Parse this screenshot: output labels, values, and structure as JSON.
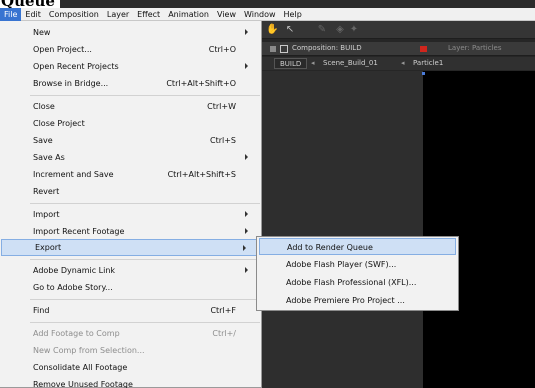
{
  "title_fragment": "Queue",
  "menubar": {
    "items": [
      {
        "label": "File",
        "active": true
      },
      {
        "label": "Edit"
      },
      {
        "label": "Composition"
      },
      {
        "label": "Layer"
      },
      {
        "label": "Effect"
      },
      {
        "label": "Animation"
      },
      {
        "label": "View"
      },
      {
        "label": "Window"
      },
      {
        "label": "Help"
      }
    ]
  },
  "panel": {
    "composition_title": "Composition: BUILD",
    "layer_title": "Layer: Particles",
    "breadcrumbs": [
      "BUILD",
      "Scene_Build_01",
      "Particle1"
    ],
    "breadcrumb_sep": "◂"
  },
  "file_menu": {
    "items": [
      {
        "label": "New",
        "shortcut": "",
        "submenu": true
      },
      {
        "label": "Open Project...",
        "shortcut": "Ctrl+O"
      },
      {
        "label": "Open Recent Projects",
        "shortcut": "",
        "submenu": true
      },
      {
        "label": "Browse in Bridge...",
        "shortcut": "Ctrl+Alt+Shift+O"
      },
      {
        "label": "Close",
        "shortcut": "Ctrl+W"
      },
      {
        "label": "Close Project",
        "shortcut": ""
      },
      {
        "label": "Save",
        "shortcut": "Ctrl+S"
      },
      {
        "label": "Save As",
        "shortcut": "",
        "submenu": true
      },
      {
        "label": "Increment and Save",
        "shortcut": "Ctrl+Alt+Shift+S"
      },
      {
        "label": "Revert",
        "shortcut": ""
      },
      {
        "label": "Import",
        "shortcut": "",
        "submenu": true
      },
      {
        "label": "Import Recent Footage",
        "shortcut": "",
        "submenu": true
      },
      {
        "label": "Export",
        "shortcut": "",
        "submenu": true,
        "highlighted": true
      },
      {
        "label": "Adobe Dynamic Link",
        "shortcut": "",
        "submenu": true
      },
      {
        "label": "Go to Adobe Story...",
        "shortcut": ""
      },
      {
        "label": "Find",
        "shortcut": "Ctrl+F"
      },
      {
        "label": "Add Footage to Comp",
        "shortcut": "Ctrl+/",
        "disabled": true
      },
      {
        "label": "New Comp from Selection...",
        "shortcut": "",
        "disabled": true
      },
      {
        "label": "Consolidate All Footage",
        "shortcut": ""
      },
      {
        "label": "Remove Unused Footage",
        "shortcut": ""
      }
    ]
  },
  "export_submenu": {
    "items": [
      {
        "label": "Add to Render Queue",
        "highlighted": true
      },
      {
        "label": "Adobe Flash Player (SWF)..."
      },
      {
        "label": "Adobe Flash Professional (XFL)..."
      },
      {
        "label": "Adobe Premiere Pro Project ..."
      }
    ]
  }
}
